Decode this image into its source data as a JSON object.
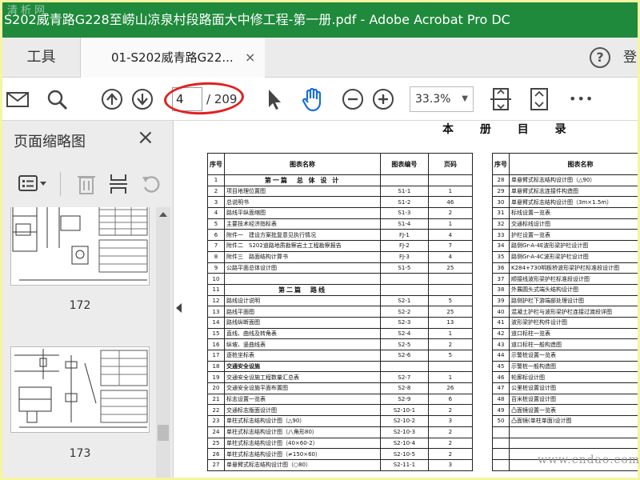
{
  "watermark_top": "清析网",
  "titlebar": {
    "title": "S202威青路G228至崂山凉泉村段路面大中修工程-第一册.pdf - Adobe Acrobat Pro DC"
  },
  "tabs": {
    "tools": "工具",
    "document": "01-S202威青路G22...",
    "close": "×",
    "login": "登"
  },
  "help": "?",
  "toolbar": {
    "page_current": "4",
    "page_total": "/ 209",
    "zoom": "33.3%",
    "zoom_caret": "▼",
    "more": "•••"
  },
  "left_panel": {
    "title": "页面缩略图",
    "close": "×",
    "thumbnails": [
      {
        "label": "172"
      },
      {
        "label": "173"
      }
    ]
  },
  "document": {
    "title": "本 册 目 录",
    "left_headers": [
      "序号",
      "图表名称",
      "图表编号",
      "页码"
    ],
    "right_headers": [
      "序号",
      "图表名称"
    ],
    "left_rows": [
      {
        "no": "1",
        "name": "第一篇　总 体 设 计",
        "code": "",
        "page": "",
        "section": true
      },
      {
        "no": "2",
        "name": "项目地理位置图",
        "code": "S1-1",
        "page": "1"
      },
      {
        "no": "3",
        "name": "总说明书",
        "code": "S1-2",
        "page": "46"
      },
      {
        "no": "4",
        "name": "路线平纵面缩图",
        "code": "S1-3",
        "page": "2"
      },
      {
        "no": "5",
        "name": "主要技术经济指标表",
        "code": "S1-4",
        "page": "1"
      },
      {
        "no": "6",
        "name": "附件一　建设方案批复意见执行情况",
        "code": "FJ-1",
        "page": "4"
      },
      {
        "no": "7",
        "name": "附件二　S202道路地质勘察岩土工程勘察报告",
        "code": "FJ-2",
        "page": "7"
      },
      {
        "no": "8",
        "name": "附件三　路面结构计算书",
        "code": "FJ-3",
        "page": "4"
      },
      {
        "no": "9",
        "name": "公路平面总体设计图",
        "code": "S1-5",
        "page": "25"
      },
      {
        "no": "10",
        "name": "",
        "code": "",
        "page": ""
      },
      {
        "no": "11",
        "name": "第二篇　路线",
        "code": "",
        "page": "",
        "section": true
      },
      {
        "no": "12",
        "name": "路线设计说明",
        "code": "S2-1",
        "page": "5"
      },
      {
        "no": "13",
        "name": "路线平面图",
        "code": "S2-2",
        "page": "25"
      },
      {
        "no": "14",
        "name": "路线纵断面图",
        "code": "S2-3",
        "page": "13"
      },
      {
        "no": "15",
        "name": "直线、曲线及转角表",
        "code": "S2-4",
        "page": "1"
      },
      {
        "no": "16",
        "name": "纵坡、竖曲线表",
        "code": "S2-5",
        "page": "2"
      },
      {
        "no": "17",
        "name": "逐桩坐标表",
        "code": "S2-6",
        "page": "5"
      },
      {
        "no": "18",
        "name": "交通安全设施",
        "code": "",
        "page": "",
        "bold": true
      },
      {
        "no": "19",
        "name": "交通安全设施工程数量汇总表",
        "code": "S2-7",
        "page": "1"
      },
      {
        "no": "20",
        "name": "交通安全设施平面布置图",
        "code": "S2-8",
        "page": "26"
      },
      {
        "no": "21",
        "name": "标志设置一览表",
        "code": "S2-9",
        "page": "6"
      },
      {
        "no": "22",
        "name": "交通标志版面设计图",
        "code": "S2-10-1",
        "page": "2"
      },
      {
        "no": "23",
        "name": "单柱式标志结构设计图（△90）",
        "code": "S2-10-2",
        "page": "3"
      },
      {
        "no": "24",
        "name": "单柱式标志结构设计图（八角形80）",
        "code": "S2-10-3",
        "page": "2"
      },
      {
        "no": "25",
        "name": "单柱式标志结构设计图（40×60-2）",
        "code": "S2-10-4",
        "page": "2"
      },
      {
        "no": "26",
        "name": "单柱式标志结构设计图（≠150×60）",
        "code": "S2-10-5",
        "page": "2"
      },
      {
        "no": "27",
        "name": "单悬臂式标志结构设计图（○80）",
        "code": "S2-11-1",
        "page": "3"
      }
    ],
    "right_rows": [
      {
        "no": "28",
        "name": "单悬臂式标志结构设计图（△90）"
      },
      {
        "no": "29",
        "name": "单悬臂式标志连接件构造图"
      },
      {
        "no": "30",
        "name": "单悬臂式标志结构设计图（3m×1.5m）"
      },
      {
        "no": "31",
        "name": "标线设置一览表"
      },
      {
        "no": "32",
        "name": "交通标线设计图"
      },
      {
        "no": "33",
        "name": "护栏设置一览表"
      },
      {
        "no": "34",
        "name": "路侧Gr-A-4E波形梁护栏设计图"
      },
      {
        "no": "35",
        "name": "路侧Gr-A-4C波形梁护栏设计图"
      },
      {
        "no": "36",
        "name": "K284+730明板桥波形梁护栏标准段设计图"
      },
      {
        "no": "37",
        "name": "顺接线波形梁护栏标准段设计图"
      },
      {
        "no": "38",
        "name": "外展圆头式端头结构设计图"
      },
      {
        "no": "39",
        "name": "路侧护栏下游端部处理设计图"
      },
      {
        "no": "40",
        "name": "混凝土护栏与波形梁护栏连接过渡段详图"
      },
      {
        "no": "41",
        "name": "波形梁护栏构件设计图"
      },
      {
        "no": "42",
        "name": "道口标柱一览表"
      },
      {
        "no": "43",
        "name": "道口标柱一般构造图"
      },
      {
        "no": "44",
        "name": "示警桩设置一览表"
      },
      {
        "no": "45",
        "name": "示警桩一般构造图"
      },
      {
        "no": "46",
        "name": "轮廓标设计图"
      },
      {
        "no": "47",
        "name": "公里桩设置设计图"
      },
      {
        "no": "48",
        "name": "百米桩设置设计图"
      },
      {
        "no": "49",
        "name": "凸面镜设置一览表"
      },
      {
        "no": "50",
        "name": "凸面镜(单柱单面)设计图"
      },
      {
        "no": "",
        "name": ""
      },
      {
        "no": "",
        "name": ""
      },
      {
        "no": "",
        "name": ""
      },
      {
        "no": "",
        "name": ""
      }
    ]
  },
  "watermark_bottom": "www.cndao.com"
}
